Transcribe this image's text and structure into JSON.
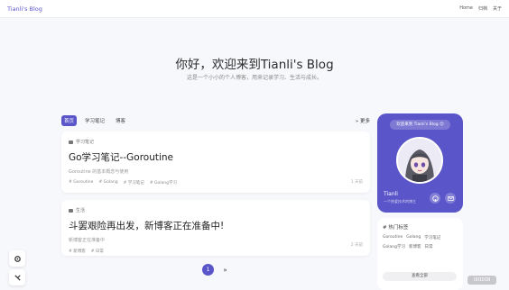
{
  "nav": {
    "brand": "Tianli's Blog",
    "links": [
      "Home",
      "归档",
      "关于"
    ]
  },
  "hero": {
    "title": "你好，欢迎来到Tianli's Blog",
    "subtitle": "这是一个小小的个人博客，用来记录学习、生活与成长。"
  },
  "tabs": {
    "items": [
      "首页",
      "学习笔记",
      "博客"
    ],
    "active_index": 0,
    "more_label": "更多"
  },
  "posts": [
    {
      "category": "学习笔记",
      "title": "Go学习笔记--Goroutine",
      "desc": "Goroutine 的基本概念与使用",
      "tags": [
        "# Goroutine",
        "# Golang",
        "# 学习笔记",
        "# Golang学习"
      ],
      "date": "1 天前"
    },
    {
      "category": "生活",
      "title": "斗罢艰险再出发，新博客正在准备中!",
      "desc": "新博客正在准备中",
      "tags": [
        "# 新博客",
        "# 日常"
      ],
      "date": "2 天前"
    }
  ],
  "pagination": {
    "current": "1",
    "next": "»"
  },
  "profile": {
    "bubble": "欢迎来到 Tianli's Blog 😊",
    "name": "Tianli",
    "desc": "一个热爱技术的博主",
    "accent": "#5a55c8"
  },
  "tagcard": {
    "title": "# 热门标签",
    "tags": [
      "Goroutine",
      "Golang",
      "学习笔记",
      "Golang学习",
      "新博客",
      "日常"
    ],
    "button": "查看全部"
  },
  "fabs": [
    {
      "icon": "gear-icon"
    },
    {
      "icon": "tool-icon"
    }
  ],
  "watermark": "UUIDIN"
}
